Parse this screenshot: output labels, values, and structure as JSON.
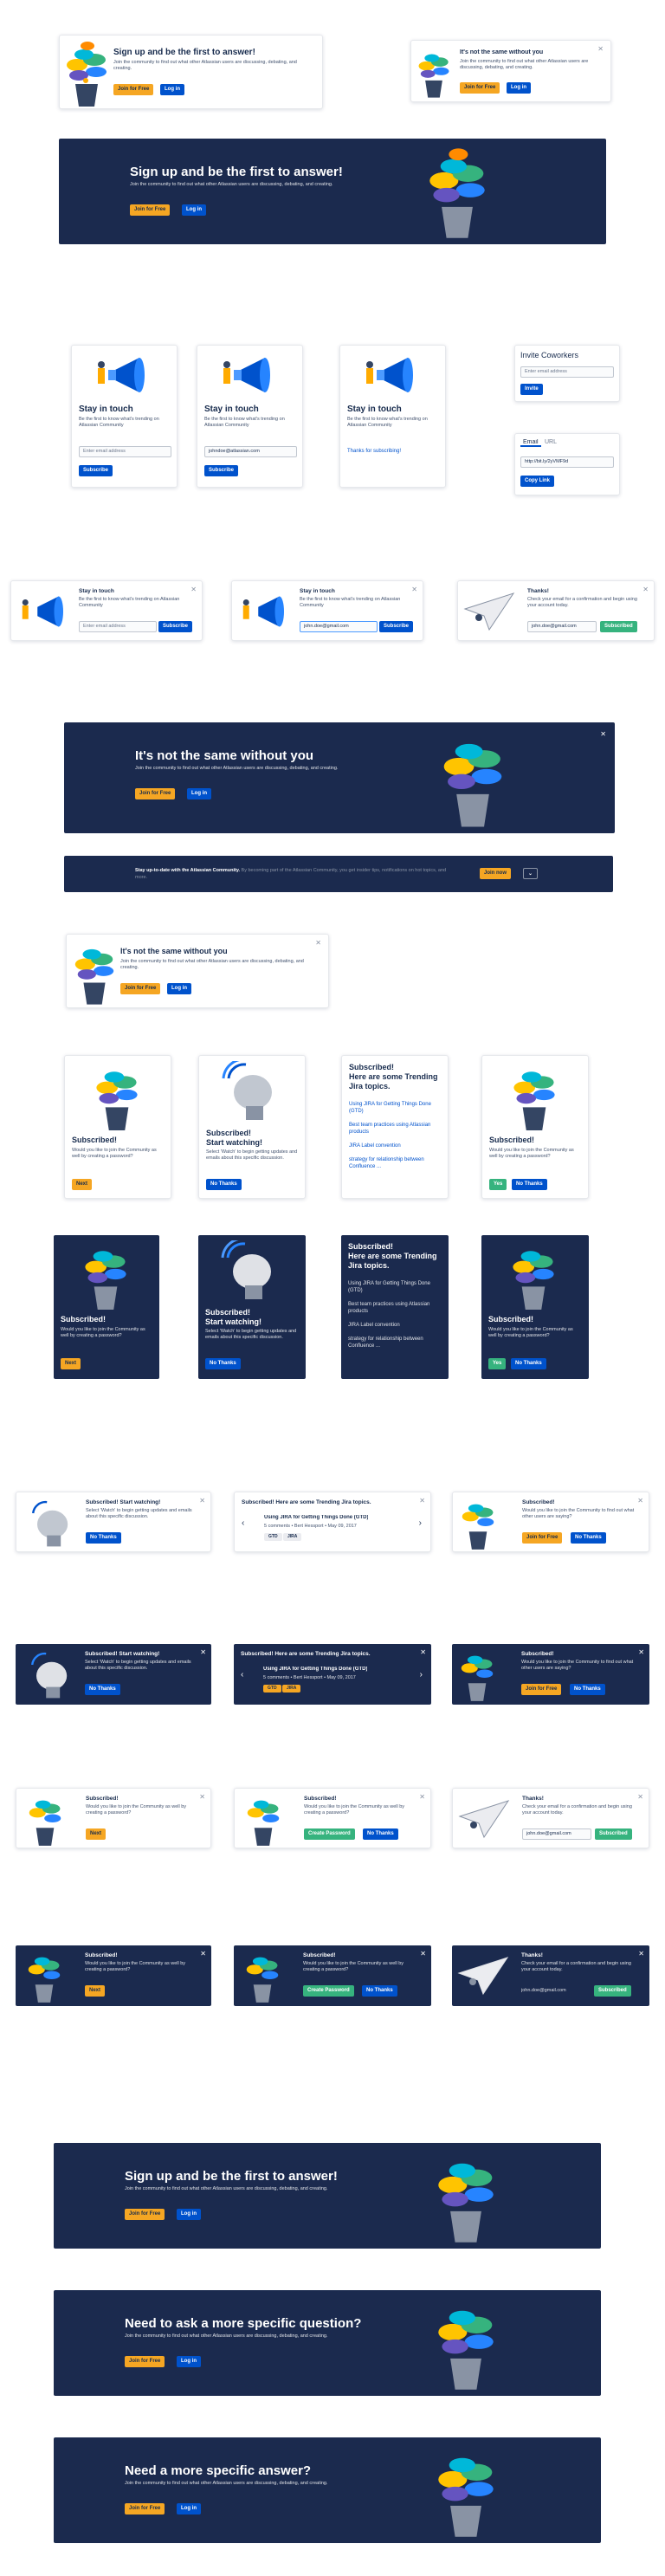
{
  "signup": {
    "title": "Sign up and be the first to answer!",
    "body": "Join the community to find out what other Atlassian users are discussing, debating, and creating.",
    "join": "Join for Free",
    "login": "Log in"
  },
  "notsame": {
    "title": "It's not the same without you",
    "body": "Join the community to find out what other Atlassian users are discussing, debating, and creating.",
    "join": "Join for Free",
    "login": "Log in"
  },
  "touch": {
    "title": "Stay in touch",
    "body": "Be the first to know what's trending on Atlassian Community",
    "placeholder": "Enter email address",
    "email": "johndoe@atlassian.com",
    "email2": "john.doe@gmail.com",
    "subscribe": "Subscribe",
    "thanks": "Thanks for subscribing!"
  },
  "invite": {
    "title": "Invite Coworkers",
    "placeholder": "Enter email address",
    "button": "Invite",
    "tab_email": "Email",
    "tab_url": "URL",
    "url": "http://bit.ly/2yVMF9d",
    "copy": "Copy Link"
  },
  "thanks": {
    "title": "Thanks!",
    "body": "Check your email for a confirmation and begin using your account today.",
    "email": "john.doe@gmail.com",
    "subscribed": "Subscribed"
  },
  "strip": {
    "lead": "Stay up-to-date with the Atlassian Community.",
    "rest": "By becoming part of the Atlassian Community, you get insider tips, notifications on hot topics, and more.",
    "join": "Join now"
  },
  "sub": {
    "title": "Subscribed!",
    "body": "Would you like to join the Community as well by creating a password?",
    "next": "Next",
    "yes": "Yes",
    "no": "No Thanks",
    "create": "Create Password",
    "join": "Join for Free",
    "body_join": "Would you like to join the Community to find out what other users are saying?"
  },
  "watch": {
    "title": "Subscribed!",
    "title2": "Start watching!",
    "body": "Select 'Watch' to begin getting updates and emails about this specific discussion.",
    "no": "No Thanks",
    "inline": "Subscribed! Start watching!"
  },
  "trend": {
    "title": "Subscribed!",
    "title2": "Here are some Trending Jira topics.",
    "inline": "Subscribed! Here are some Trending Jira topics.",
    "topics": [
      "Using JIRA for Getting Things Done (GTD)",
      "Best team practices using Atlassian products",
      "JIRA Label convention",
      "strategy for relationship between Confluence ..."
    ],
    "item_title": "Using JIRA for Getting Things Done (GTD)",
    "item_meta": "5 comments • Bert Hessport • May 09, 2017",
    "tags": [
      "GTD",
      "JIRA"
    ]
  },
  "ask": {
    "title": "Need to ask a more specific question?",
    "title2": "Need a more specific answer?",
    "body": "Join the community to find out what other Atlassian users are discussing, debating, and creating.",
    "join": "Join for Free",
    "login": "Log in"
  },
  "icons": {
    "close": "✕",
    "prev": "‹",
    "next": "›",
    "down": "⌄"
  },
  "colors": {
    "navy": "#1b2a4e",
    "yellow": "#f5a623",
    "blue": "#0052cc",
    "green": "#36b37e"
  }
}
